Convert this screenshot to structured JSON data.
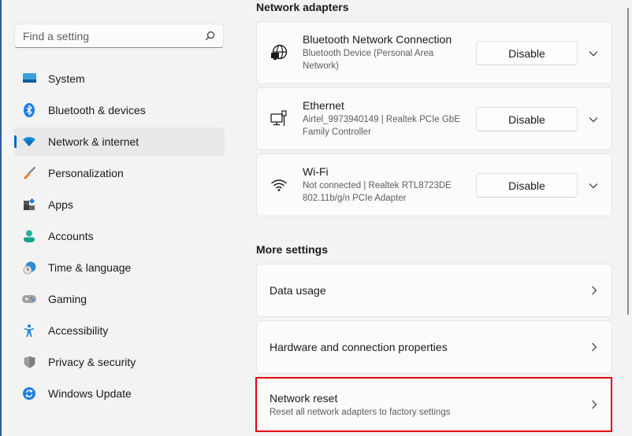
{
  "sidebar": {
    "search": {
      "placeholder": "Find a setting",
      "value": "",
      "icon": "search-icon"
    },
    "items": [
      {
        "label": "System",
        "icon": "system-icon",
        "active": false
      },
      {
        "label": "Bluetooth & devices",
        "icon": "bluetooth-icon",
        "active": false
      },
      {
        "label": "Network & internet",
        "icon": "wifi-network-icon",
        "active": true
      },
      {
        "label": "Personalization",
        "icon": "paintbrush-icon",
        "active": false
      },
      {
        "label": "Apps",
        "icon": "apps-icon",
        "active": false
      },
      {
        "label": "Accounts",
        "icon": "account-icon",
        "active": false
      },
      {
        "label": "Time & language",
        "icon": "clock-globe-icon",
        "active": false
      },
      {
        "label": "Gaming",
        "icon": "gamepad-icon",
        "active": false
      },
      {
        "label": "Accessibility",
        "icon": "accessibility-icon",
        "active": false
      },
      {
        "label": "Privacy & security",
        "icon": "shield-icon",
        "active": false
      },
      {
        "label": "Windows Update",
        "icon": "update-icon",
        "active": false
      }
    ]
  },
  "main": {
    "adapters_title": "Network adapters",
    "adapters": [
      {
        "name": "Bluetooth Network Connection",
        "description": "Bluetooth Device (Personal Area Network)",
        "button": "Disable",
        "icon": "globe-monitor-icon"
      },
      {
        "name": "Ethernet",
        "description": "Airtel_9973940149 | Realtek PCIe GbE Family Controller",
        "button": "Disable",
        "icon": "ethernet-icon"
      },
      {
        "name": "Wi-Fi",
        "description": "Not connected | Realtek RTL8723DE 802.11b/g/n PCIe Adapter",
        "button": "Disable",
        "icon": "wifi-icon"
      }
    ],
    "more_title": "More settings",
    "more": [
      {
        "title": "Data usage",
        "subtitle": ""
      },
      {
        "title": "Hardware and connection properties",
        "subtitle": ""
      },
      {
        "title": "Network reset",
        "subtitle": "Reset all network adapters to factory settings",
        "highlighted": true
      }
    ]
  },
  "colors": {
    "accent": "#0067c0",
    "highlight_border": "#e8000c",
    "background": "#f3f3f3",
    "card": "#fbfbfb"
  }
}
